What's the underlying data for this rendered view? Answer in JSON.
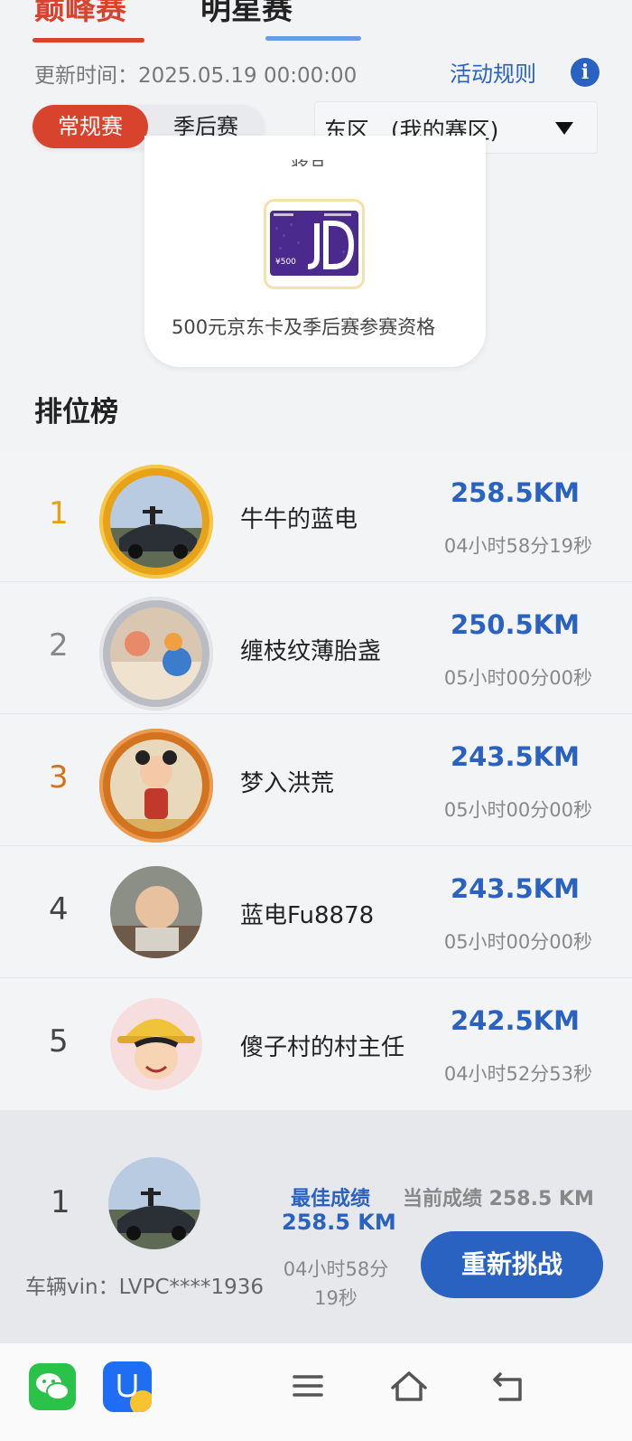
{
  "tabs": [
    {
      "label": "巅峰赛",
      "active": true
    },
    {
      "label": "明星赛",
      "active": false
    }
  ],
  "update_time": "更新时间：2025.05.19 00:00:00",
  "rules_link": "活动规则",
  "season_toggle": [
    "常规赛",
    "季后赛"
  ],
  "region_select": "东区   (我的赛区)",
  "prize": {
    "header": "奖品",
    "card_value": "¥500",
    "description": "500元京东卡及季后赛参赛资格"
  },
  "ranking": {
    "title": "排位榜",
    "rows": [
      {
        "rank": "1",
        "name": "牛牛的蓝电",
        "distance": "258.5KM",
        "time": "04小时58分19秒"
      },
      {
        "rank": "2",
        "name": "缠枝纹薄胎盏",
        "distance": "250.5KM",
        "time": "05小时00分00秒"
      },
      {
        "rank": "3",
        "name": "梦入洪荒",
        "distance": "243.5KM",
        "time": "05小时00分00秒"
      },
      {
        "rank": "4",
        "name": "蓝电Fu8878",
        "distance": "243.5KM",
        "time": "05小时00分00秒"
      },
      {
        "rank": "5",
        "name": "傻子村的村主任",
        "distance": "242.5KM",
        "time": "04小时52分53秒"
      }
    ]
  },
  "my_record": {
    "rank": "1",
    "vin": "车辆vin：LVPC****1936",
    "best_label": "最佳成绩",
    "best_value": "258.5 KM",
    "best_time": "04小时58分19秒",
    "current": "当前成绩 258.5 KM",
    "retry_button": "重新挑战"
  },
  "colors": {
    "accent_red": "#d8432e",
    "accent_blue": "#2a62c2",
    "gold": "#e8a21a",
    "silver": "#b9bcc2",
    "bronze": "#d2731f"
  }
}
